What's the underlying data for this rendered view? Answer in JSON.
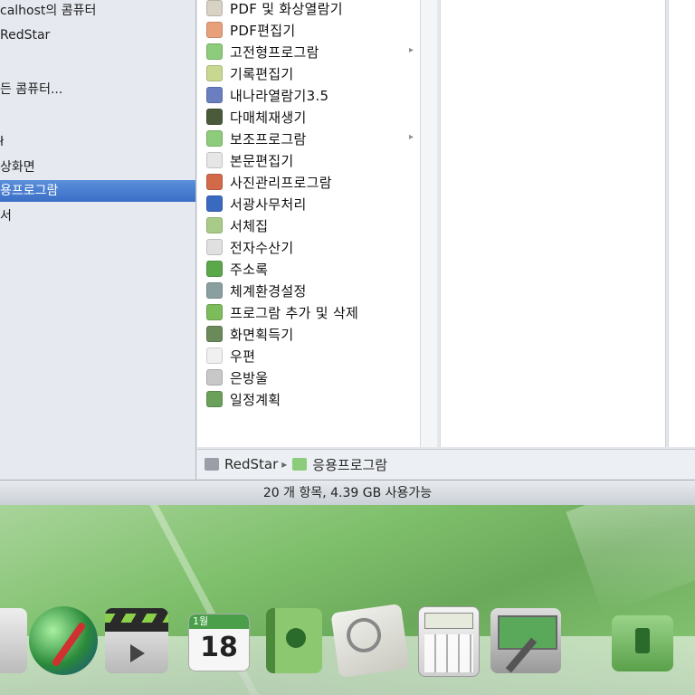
{
  "sidebar": {
    "items": [
      {
        "label": "calhost의 콤퓨터"
      },
      {
        "label": "RedStar"
      },
      {
        "label": ""
      },
      {
        "label": "든 콤퓨터..."
      },
      {
        "label": ""
      },
      {
        "label": "ł"
      },
      {
        "label": "상화면"
      },
      {
        "label": "용프로그람",
        "selected": true
      },
      {
        "label": "서"
      }
    ]
  },
  "apps": [
    {
      "label": "PDF 및 화상열람기",
      "icon": "pdf-viewer-icon",
      "color": "#d8d2c4"
    },
    {
      "label": "PDF편집기",
      "icon": "pdf-editor-icon",
      "color": "#e8a07a"
    },
    {
      "label": "고전형프로그람",
      "icon": "folder-icon",
      "color": "#8ccc7a",
      "has_submenu": true
    },
    {
      "label": "기록편집기",
      "icon": "notepad-icon",
      "color": "#c8d890"
    },
    {
      "label": "내나라열람기3.5",
      "icon": "browser-globe-icon",
      "color": "#6a7fc0"
    },
    {
      "label": "다매체재생기",
      "icon": "media-player-icon",
      "color": "#4a5a3a"
    },
    {
      "label": "보조프로그람",
      "icon": "folder-icon",
      "color": "#8ccc7a",
      "has_submenu": true
    },
    {
      "label": "본문편집기",
      "icon": "text-editor-icon",
      "color": "#e6e6e6"
    },
    {
      "label": "사진관리프로그람",
      "icon": "photo-manager-icon",
      "color": "#d26a4a"
    },
    {
      "label": "서광사무처리",
      "icon": "office-icon",
      "color": "#3a6ac0"
    },
    {
      "label": "서체집",
      "icon": "font-book-icon",
      "color": "#a8cc88"
    },
    {
      "label": "전자수산기",
      "icon": "calculator-icon",
      "color": "#e0e0e0"
    },
    {
      "label": "주소록",
      "icon": "address-book-icon",
      "color": "#5aa84a"
    },
    {
      "label": "체계환경설정",
      "icon": "system-settings-icon",
      "color": "#8aa0a0"
    },
    {
      "label": "프로그람 추가 및 삭제",
      "icon": "add-remove-programs-icon",
      "color": "#7cbc5a"
    },
    {
      "label": "화면획득기",
      "icon": "screenshot-icon",
      "color": "#6a8a5a"
    },
    {
      "label": "우편",
      "icon": "mail-icon",
      "color": "#f0f0f0"
    },
    {
      "label": "은방울",
      "icon": "bell-icon",
      "color": "#c8c8c8"
    },
    {
      "label": "일정계획",
      "icon": "calendar-icon",
      "color": "#6aa05a"
    }
  ],
  "pathbar": {
    "root": "RedStar",
    "separator": "▸",
    "current": "응용프로그람"
  },
  "status": {
    "text": "20 개 항목, 4.39 GB 사용가능"
  },
  "dock": {
    "items": [
      {
        "icon": "files-icon"
      },
      {
        "icon": "browser-globe-icon"
      },
      {
        "icon": "media-player-icon"
      },
      {
        "icon": "calendar-icon",
        "month": "1월",
        "day": "18"
      },
      {
        "icon": "address-book-icon"
      },
      {
        "icon": "document-viewer-icon"
      },
      {
        "icon": "calculator-icon"
      },
      {
        "icon": "system-settings-icon"
      },
      {
        "icon": "folder-icon"
      }
    ]
  }
}
